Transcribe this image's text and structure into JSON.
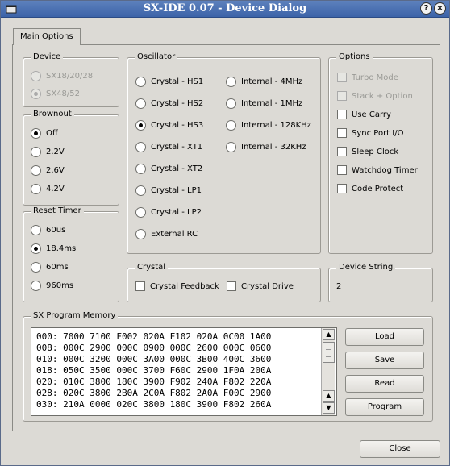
{
  "window": {
    "title": "SX-IDE 0.07 - Device Dialog",
    "help_label": "?",
    "close_label": "×"
  },
  "tabs": [
    {
      "label": "Main Options",
      "active": true
    }
  ],
  "device": {
    "legend": "Device",
    "options": [
      {
        "label": "SX18/20/28",
        "checked": false,
        "enabled": false
      },
      {
        "label": "SX48/52",
        "checked": true,
        "enabled": false
      }
    ]
  },
  "brownout": {
    "legend": "Brownout",
    "options": [
      {
        "label": "Off",
        "checked": true
      },
      {
        "label": "2.2V",
        "checked": false
      },
      {
        "label": "2.6V",
        "checked": false
      },
      {
        "label": "4.2V",
        "checked": false
      }
    ]
  },
  "reset_timer": {
    "legend": "Reset Timer",
    "options": [
      {
        "label": "60us",
        "checked": false
      },
      {
        "label": "18.4ms",
        "checked": true
      },
      {
        "label": "60ms",
        "checked": false
      },
      {
        "label": "960ms",
        "checked": false
      }
    ]
  },
  "oscillator": {
    "legend": "Oscillator",
    "col1": [
      {
        "label": "Crystal - HS1",
        "checked": false
      },
      {
        "label": "Crystal - HS2",
        "checked": false
      },
      {
        "label": "Crystal - HS3",
        "checked": true
      },
      {
        "label": "Crystal - XT1",
        "checked": false
      },
      {
        "label": "Crystal - XT2",
        "checked": false
      },
      {
        "label": "Crystal - LP1",
        "checked": false
      },
      {
        "label": "Crystal - LP2",
        "checked": false
      },
      {
        "label": "External RC",
        "checked": false
      }
    ],
    "col2": [
      {
        "label": "Internal - 4MHz",
        "checked": false
      },
      {
        "label": "Internal - 1MHz",
        "checked": false
      },
      {
        "label": "Internal - 128KHz",
        "checked": false
      },
      {
        "label": "Internal - 32KHz",
        "checked": false
      }
    ]
  },
  "options": {
    "legend": "Options",
    "items": [
      {
        "label": "Turbo Mode",
        "checked": false,
        "enabled": false
      },
      {
        "label": "Stack + Option",
        "checked": false,
        "enabled": false
      },
      {
        "label": "Use Carry",
        "checked": false,
        "enabled": true
      },
      {
        "label": "Sync Port I/O",
        "checked": false,
        "enabled": true
      },
      {
        "label": "Sleep Clock",
        "checked": false,
        "enabled": true
      },
      {
        "label": "Watchdog Timer",
        "checked": false,
        "enabled": true
      },
      {
        "label": "Code Protect",
        "checked": false,
        "enabled": true
      }
    ]
  },
  "crystal": {
    "legend": "Crystal",
    "items": [
      {
        "label": "Crystal Feedback",
        "checked": false
      },
      {
        "label": "Crystal Drive",
        "checked": false
      }
    ]
  },
  "device_string": {
    "legend": "Device String",
    "value": "2"
  },
  "program_memory": {
    "legend": "SX Program Memory",
    "lines": [
      "000: 7000 7100 F002 020A F102 020A 0C00 1A00",
      "008: 000C 2900 000C 0900 000C 2600 000C 0600",
      "010: 000C 3200 000C 3A00 000C 3B00 400C 3600",
      "018: 050C 3500 000C 3700 F60C 2900 1F0A 200A",
      "020: 010C 3800 180C 3900 F902 240A F802 220A",
      "028: 020C 3800 2B0A 2C0A F802 2A0A F00C 2900",
      "030: 210A 0000 020C 3800 180C 3900 F802 260A"
    ],
    "buttons": {
      "load": "Load",
      "save": "Save",
      "read": "Read",
      "program": "Program"
    }
  },
  "footer": {
    "close": "Close"
  }
}
